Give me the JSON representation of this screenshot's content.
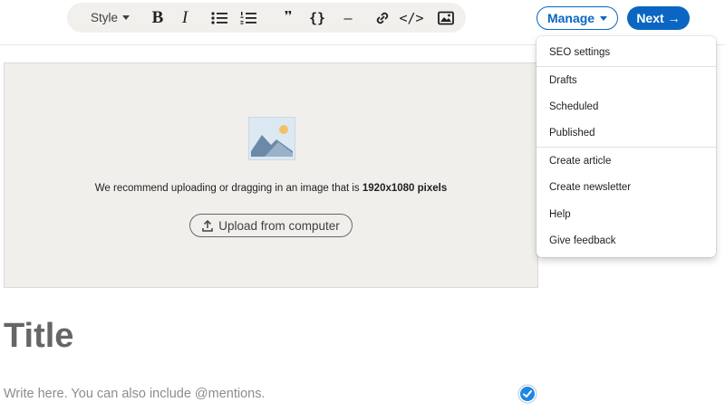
{
  "toolbar": {
    "style_label": "Style",
    "bold_label": "B",
    "italic_label": "I",
    "quote_label": "❞",
    "code_block_label": "{}",
    "divider_label": "—",
    "code_label": "</>"
  },
  "header": {
    "manage_label": "Manage",
    "next_label": "Next",
    "next_arrow": "→",
    "accent_color": "#0a66c2"
  },
  "cover": {
    "recommend_text": "We recommend uploading or dragging in an image that is ",
    "recommend_size": "1920x1080 pixels",
    "upload_label": "Upload from computer"
  },
  "editor": {
    "title_placeholder": "Title",
    "body_placeholder": "Write here. You can also include @mentions."
  },
  "manage_menu": {
    "items": [
      "SEO settings",
      "Drafts",
      "Scheduled",
      "Published",
      "Create article",
      "Create newsletter",
      "Help",
      "Give feedback"
    ]
  }
}
